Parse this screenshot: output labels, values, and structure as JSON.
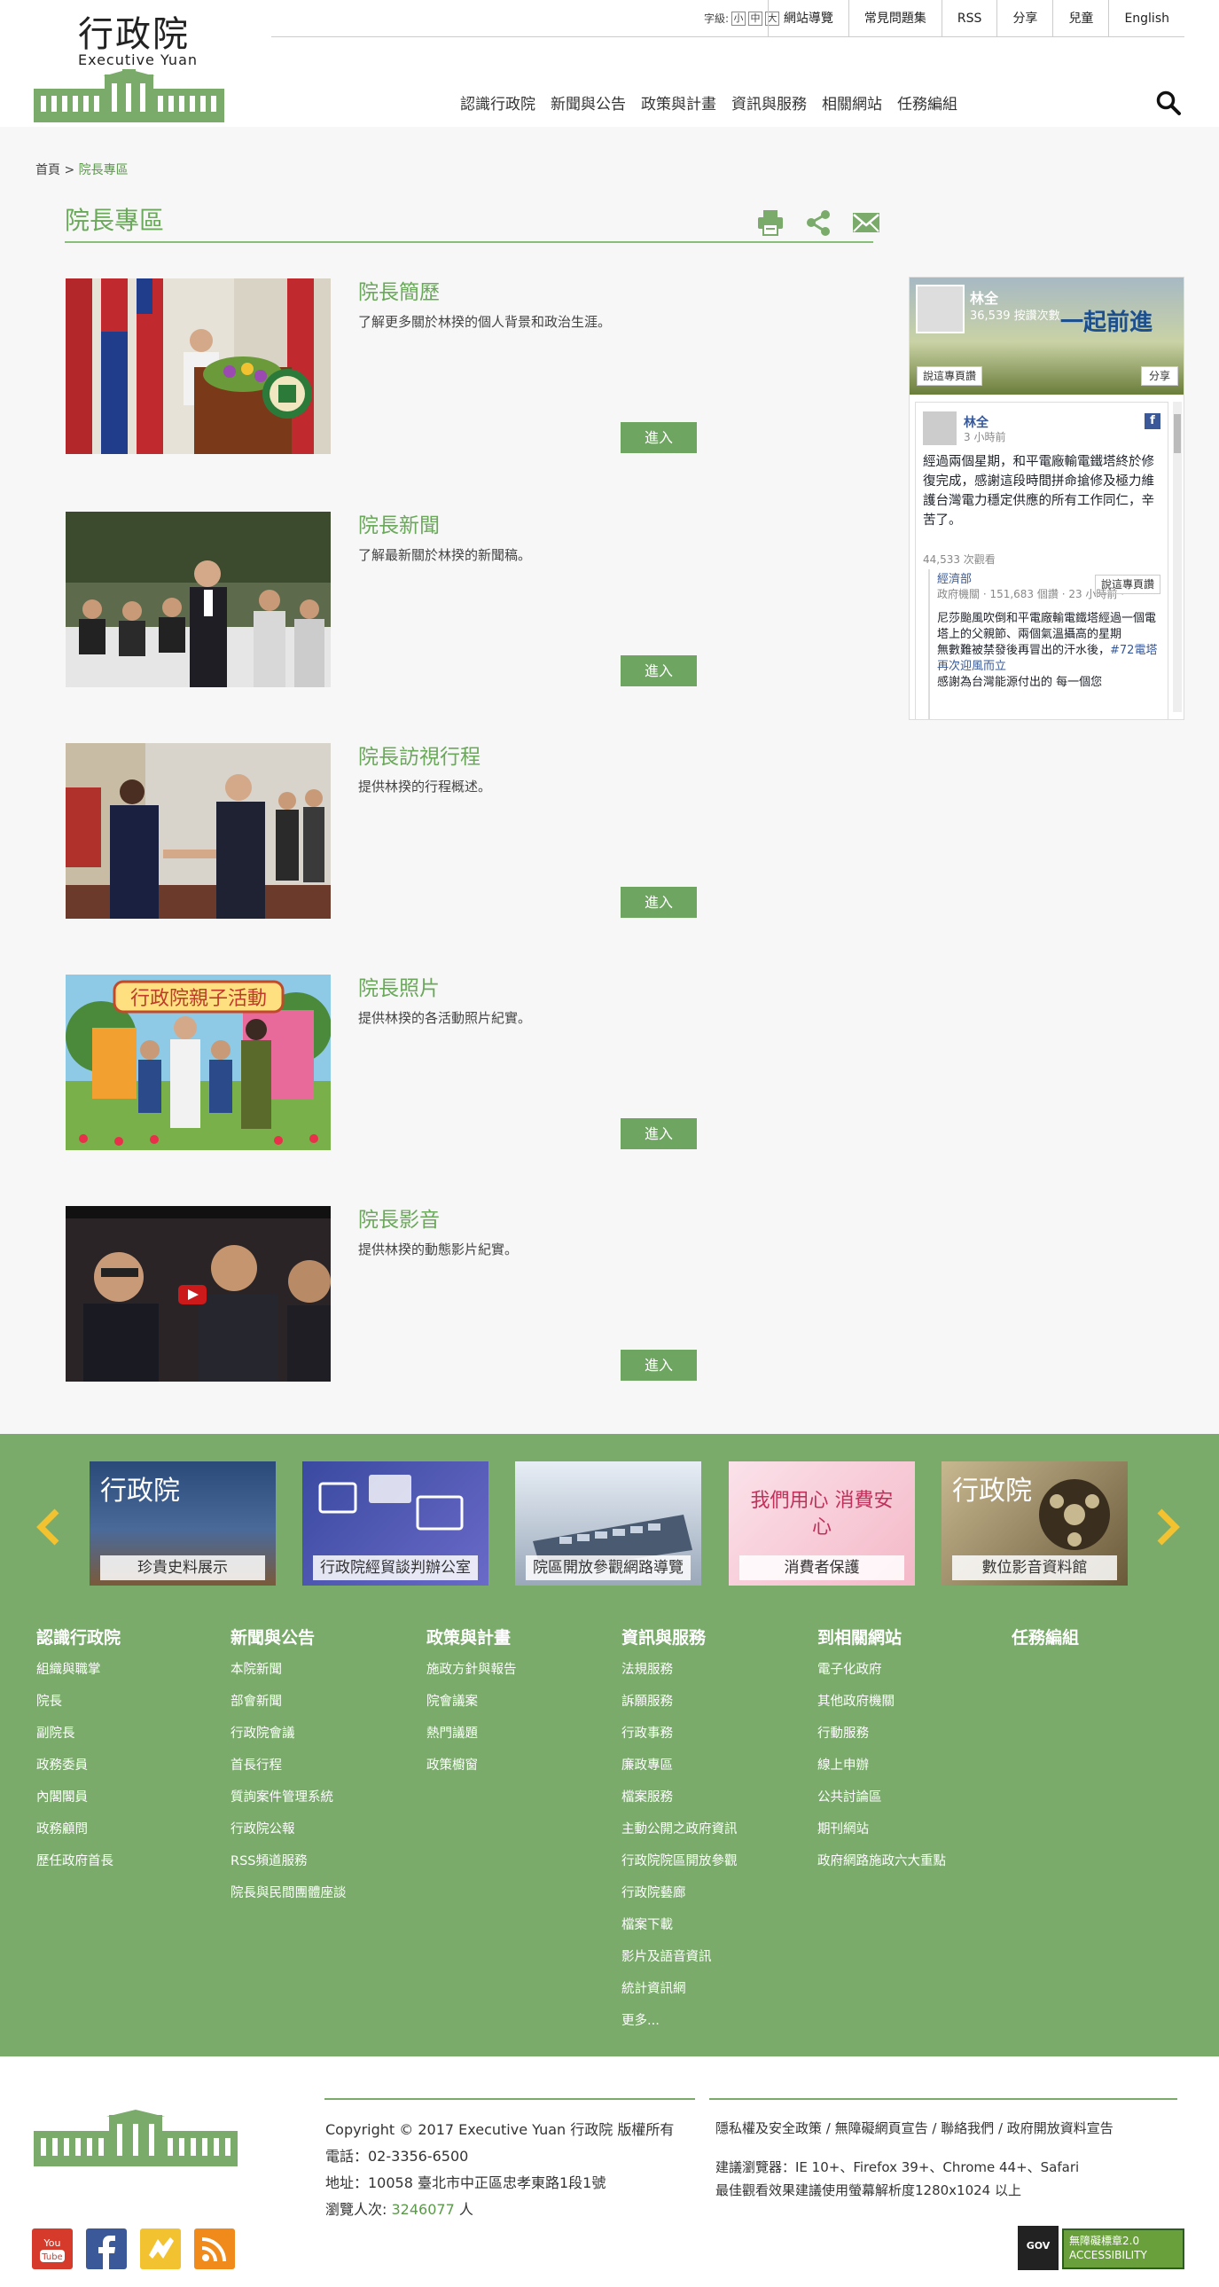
{
  "header": {
    "logo_title": "行政院",
    "logo_en": "Executive Yuan",
    "fontsize_label": "字級:",
    "fontsize_options": [
      "小",
      "中",
      "大"
    ],
    "top_links": [
      "網站導覽",
      "常見問題集",
      "RSS",
      "分享",
      "兒童",
      "English"
    ],
    "main_nav": [
      "認識行政院",
      "新聞與公告",
      "政策與計畫",
      "資訊與服務",
      "相關網站",
      "任務編組"
    ]
  },
  "breadcrumb": {
    "home": "首頁",
    "sep": ">",
    "current": "院長專區"
  },
  "page_title": "院長專區",
  "items": [
    {
      "title": "院長簡歷",
      "desc": "了解更多關於林揆的個人背景和政治生涯。",
      "button": "進入"
    },
    {
      "title": "院長新聞",
      "desc": "了解最新關於林揆的新聞稿。",
      "button": "進入"
    },
    {
      "title": "院長訪視行程",
      "desc": "提供林揆的行程概述。",
      "button": "進入"
    },
    {
      "title": "院長照片",
      "desc": "提供林揆的各活動照片紀實。",
      "button": "進入"
    },
    {
      "title": "院長影音",
      "desc": "提供林揆的動態影片紀實。",
      "button": "進入"
    }
  ],
  "photo_banner_text": "行政院親子活動",
  "fb": {
    "page_name": "林全",
    "likes": "36,539 按讚次數",
    "slogan": "一起前進",
    "like_btn": "說這專頁讚",
    "share_btn": "分享",
    "post_name": "林全",
    "post_time": "3 小時前",
    "post_text": "經過兩個星期，和平電廠輸電鐵塔終於修復完成，感謝這段時間拼命搶修及極力維護台灣電力穩定供應的所有工作同仁，辛苦了。",
    "post_views": "44,533 次觀看",
    "shared_name": "經濟部",
    "shared_meta1": "政府機關 · 151,683 個讚 · 23 小時前 ·",
    "shared_btn": "說這專頁讚",
    "shared_text": "尼莎颱風吹倒和平電廠輸電鐵塔經過一個電塔上的父親節、兩個氣溫攝高的星期",
    "shared_text2": "無數難被禁發後再冒出的汗水後，",
    "shared_tag": "#72電塔再次迎風而立",
    "shared_text3": "感謝為台灣能源付出的 每一個您"
  },
  "banners": [
    {
      "title": "行政院",
      "caption": "珍貴史料展示"
    },
    {
      "title": "",
      "caption": "行政院經貿談判辦公室"
    },
    {
      "title": "",
      "caption": "院區開放參觀網路導覽"
    },
    {
      "title": "我們用心 消費安心",
      "caption": "消費者保護"
    },
    {
      "title": "行政院",
      "caption": "數位影音資料館"
    }
  ],
  "footer_columns": [
    {
      "heading": "認識行政院",
      "links": [
        "組織與職掌",
        "院長",
        "副院長",
        "政務委員",
        "內閣閣員",
        "政務顧問",
        "歷任政府首長"
      ]
    },
    {
      "heading": "新聞與公告",
      "links": [
        "本院新聞",
        "部會新聞",
        "行政院會議",
        "首長行程",
        "質詢案件管理系統",
        "行政院公報",
        "RSS頻道服務",
        "院長與民間團體座談"
      ]
    },
    {
      "heading": "政策與計畫",
      "links": [
        "施政方針與報告",
        "院會議案",
        "熱門議題",
        "政策櫥窗"
      ]
    },
    {
      "heading": "資訊與服務",
      "links": [
        "法規服務",
        "訴願服務",
        "行政事務",
        "廉政專區",
        "檔案服務",
        "主動公開之政府資訊",
        "行政院院區開放參觀",
        "行政院藝廊",
        "檔案下載",
        "影片及語音資訊",
        "統計資訊網",
        "更多..."
      ]
    },
    {
      "heading": "到相關網站",
      "links": [
        "電子化政府",
        "其他政府機關",
        "行動服務",
        "線上申辦",
        "公共討論區",
        "期刊網站",
        "政府網路施政六大重點"
      ]
    },
    {
      "heading": "任務編組",
      "links": []
    }
  ],
  "bottom": {
    "copyright": "Copyright © 2017 Executive Yuan 行政院 版權所有",
    "phone": "電話：02-3356-6500",
    "address": "地址：10058 臺北市中正區忠孝東路1段1號",
    "visits_label": "瀏覽人次:",
    "visits_num": "3246077",
    "visits_unit": "人",
    "links": "隱私權及安全政策 / 無障礙網頁宣告 / 聯絡我們 / 政府開放資料宣告",
    "browser": "建議瀏覽器：IE 10+、Firefox 39+、Chrome 44+、Safari",
    "resolution": "最佳觀看效果建議使用螢幕解析度1280x1024 以上",
    "badge_gov": "GOV",
    "badge_access": "無障礙標章2.0 ACCESSIBILITY"
  },
  "colors": {
    "brand_green": "#7aab6b",
    "title_green": "#6aa85a",
    "button_green": "#6ea560",
    "arrow_yellow": "#f2c230"
  }
}
